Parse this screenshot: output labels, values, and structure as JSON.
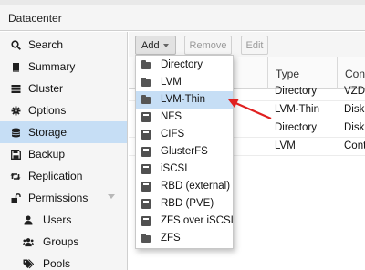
{
  "window": {
    "title": "Datacenter"
  },
  "sidebar": {
    "items": [
      {
        "label": "Search",
        "icon": "search-icon"
      },
      {
        "label": "Summary",
        "icon": "book-icon"
      },
      {
        "label": "Cluster",
        "icon": "server-list-icon"
      },
      {
        "label": "Options",
        "icon": "gear-icon"
      },
      {
        "label": "Storage",
        "icon": "database-icon",
        "active": true
      },
      {
        "label": "Backup",
        "icon": "floppy-icon"
      },
      {
        "label": "Replication",
        "icon": "retweet-icon"
      },
      {
        "label": "Permissions",
        "icon": "unlock-icon",
        "expandable": true
      },
      {
        "label": "Users",
        "icon": "user-icon"
      },
      {
        "label": "Groups",
        "icon": "users-icon"
      },
      {
        "label": "Pools",
        "icon": "tags-icon"
      }
    ]
  },
  "toolbar": {
    "add_label": "Add",
    "remove_label": "Remove",
    "edit_label": "Edit"
  },
  "grid": {
    "columns": [
      "Type",
      "Cont"
    ],
    "rows": [
      {
        "type": "Directory",
        "content": "VZDu"
      },
      {
        "type": "LVM-Thin",
        "content": "Disk"
      },
      {
        "type": "Directory",
        "content": "Disk"
      },
      {
        "type": "LVM",
        "content": "Cont"
      }
    ]
  },
  "add_menu": {
    "items": [
      {
        "label": "Directory",
        "icon": "folder-icon"
      },
      {
        "label": "LVM",
        "icon": "folder-icon"
      },
      {
        "label": "LVM-Thin",
        "icon": "folder-icon",
        "highlighted": true
      },
      {
        "label": "NFS",
        "icon": "disk-icon"
      },
      {
        "label": "CIFS",
        "icon": "disk-icon"
      },
      {
        "label": "GlusterFS",
        "icon": "disk-icon"
      },
      {
        "label": "iSCSI",
        "icon": "disk-icon"
      },
      {
        "label": "RBD (external)",
        "icon": "disk-icon"
      },
      {
        "label": "RBD (PVE)",
        "icon": "disk-icon"
      },
      {
        "label": "ZFS over iSCSI",
        "icon": "disk-icon"
      },
      {
        "label": "ZFS",
        "icon": "folder-icon"
      }
    ]
  },
  "colors": {
    "selection": "#c6def5",
    "annotation_arrow": "#e02020"
  }
}
